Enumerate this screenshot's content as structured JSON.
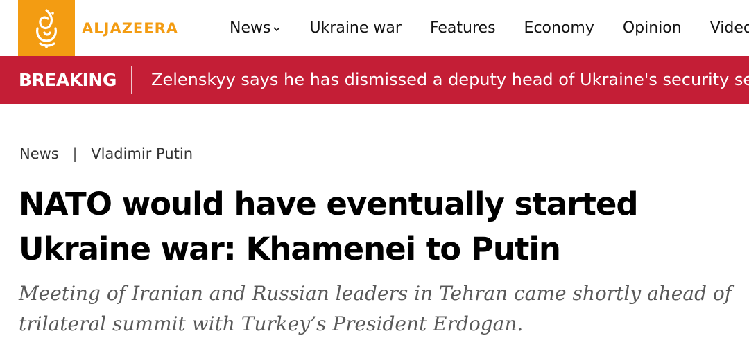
{
  "brand": {
    "name": "ALJAZEERA",
    "logo_icon": "aljazeera-calligraphy-logo",
    "accent_color": "#f39c12"
  },
  "nav": {
    "items": [
      {
        "label": "News",
        "has_dropdown": true
      },
      {
        "label": "Ukraine war"
      },
      {
        "label": "Features"
      },
      {
        "label": "Economy"
      },
      {
        "label": "Opinion"
      },
      {
        "label": "Video"
      }
    ]
  },
  "breaking": {
    "label": "BREAKING",
    "text": "Zelenskyy says he has dismissed a deputy head of Ukraine's security service",
    "bg_color": "#c41e36"
  },
  "breadcrumb": {
    "items": [
      "News",
      "Vladimir Putin"
    ],
    "separator": "|"
  },
  "article": {
    "headline": "NATO would have eventually started Ukraine war: Khamenei to Putin",
    "subheading": "Meeting of Iranian and Russian leaders in Tehran came shortly ahead of trilateral summit with Turkey’s President Erdogan."
  }
}
